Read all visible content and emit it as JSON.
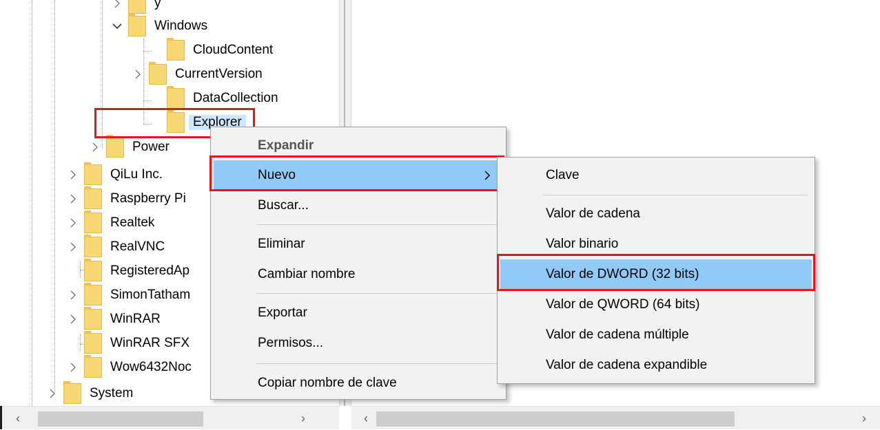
{
  "tree": {
    "items": [
      {
        "label": "y",
        "expander": "chevron-right"
      },
      {
        "label": "Windows",
        "expander": "chevron-down"
      },
      {
        "label": "CloudContent",
        "expander": "none"
      },
      {
        "label": "CurrentVersion",
        "expander": "chevron-right"
      },
      {
        "label": "DataCollection",
        "expander": "none"
      },
      {
        "label": "Explorer",
        "expander": "none",
        "selected": true
      },
      {
        "label": "Power",
        "expander": "chevron-right"
      },
      {
        "label": "QiLu Inc.",
        "expander": "chevron-right"
      },
      {
        "label": "Raspberry Pi",
        "expander": "chevron-right"
      },
      {
        "label": "Realtek",
        "expander": "chevron-right"
      },
      {
        "label": "RealVNC",
        "expander": "chevron-right"
      },
      {
        "label": "RegisteredAp",
        "expander": "none"
      },
      {
        "label": "SimonTatham",
        "expander": "chevron-right"
      },
      {
        "label": "WinRAR",
        "expander": "chevron-right"
      },
      {
        "label": "WinRAR SFX",
        "expander": "none"
      },
      {
        "label": "Wow6432Noc",
        "expander": "chevron-right"
      },
      {
        "label": "System",
        "expander": "chevron-right"
      }
    ]
  },
  "context_menu": {
    "items": [
      {
        "label": "Expandir",
        "style": "bold"
      },
      {
        "label": "Nuevo",
        "highlighted": true,
        "has_submenu": true
      },
      {
        "label": "Buscar..."
      },
      {
        "label": "Eliminar"
      },
      {
        "label": "Cambiar nombre"
      },
      {
        "label": "Exportar"
      },
      {
        "label": "Permisos..."
      },
      {
        "label": "Copiar nombre de clave"
      }
    ]
  },
  "submenu": {
    "items": [
      {
        "label": "Clave"
      },
      {
        "label": "Valor de cadena"
      },
      {
        "label": "Valor binario"
      },
      {
        "label": "Valor de DWORD (32 bits)",
        "highlighted": true
      },
      {
        "label": "Valor de QWORD (64 bits)"
      },
      {
        "label": "Valor de cadena múltiple"
      },
      {
        "label": "Valor de cadena expandible"
      }
    ]
  },
  "scrollbars": {
    "left_arrow": "‹",
    "right_arrow": "›"
  },
  "colors": {
    "highlight": "#91c9f7",
    "annotation_red": "#e8141b",
    "folder": "#f8d775",
    "selection": "#cce8ff"
  }
}
